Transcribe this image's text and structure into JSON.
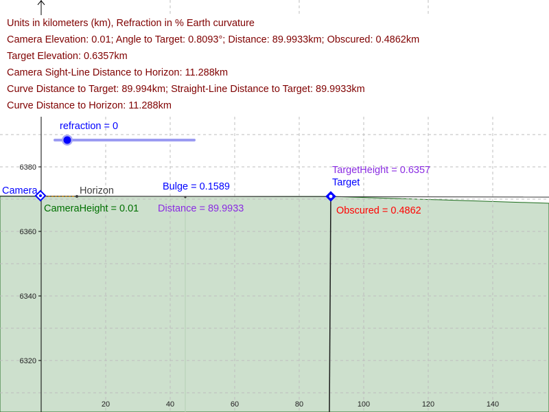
{
  "colors": {
    "info_text": "#7f0000",
    "camera": "#0000ff",
    "horizon": "#404040",
    "camera_height": "#007000",
    "bulge": "#0000ff",
    "distance": "#8a2be2",
    "target_height": "#8a2be2",
    "target": "#0000ff",
    "obscured": "#ff0000",
    "earth_fill": "#cde0cd",
    "slider": "#0000ff",
    "slider_track": "#9b9bf2",
    "grid": "#bdbdbd"
  },
  "info_lines": [
    "Units in kilometers (km), Refraction in % Earth curvature",
    "Camera Elevation: 0.01; Angle to Target: 0.8093°; Distance: 89.9933km; Obscured: 0.4862km",
    "Target Elevation: 0.6357km",
    "Camera Sight-Line Distance to Horizon: 11.288km",
    "Curve Distance to Target: 89.994km; Straight-Line Distance to Target: 89.9933km",
    "Curve Distance to Horizon: 11.288km"
  ],
  "slider": {
    "label": "refraction = 0",
    "value": 0
  },
  "labels": {
    "camera": "Camera",
    "horizon": "Horizon",
    "camera_height": "CameraHeight = 0.01",
    "bulge": "Bulge = 0.1589",
    "distance": "Distance = 89.9933",
    "target_height": "TargetHeight = 0.6357",
    "target": "Target",
    "obscured": "Obscured = 0.4862"
  },
  "axes": {
    "x_ticks": [
      20,
      40,
      60,
      80,
      100,
      120,
      140
    ],
    "y_ticks": [
      6320,
      6340,
      6360,
      6380
    ]
  },
  "geometry_data": {
    "camera": [
      0,
      6371.01
    ],
    "horizon_x": 11.288,
    "bulge_x": 45,
    "target": [
      89.9933,
      6370.64
    ]
  }
}
